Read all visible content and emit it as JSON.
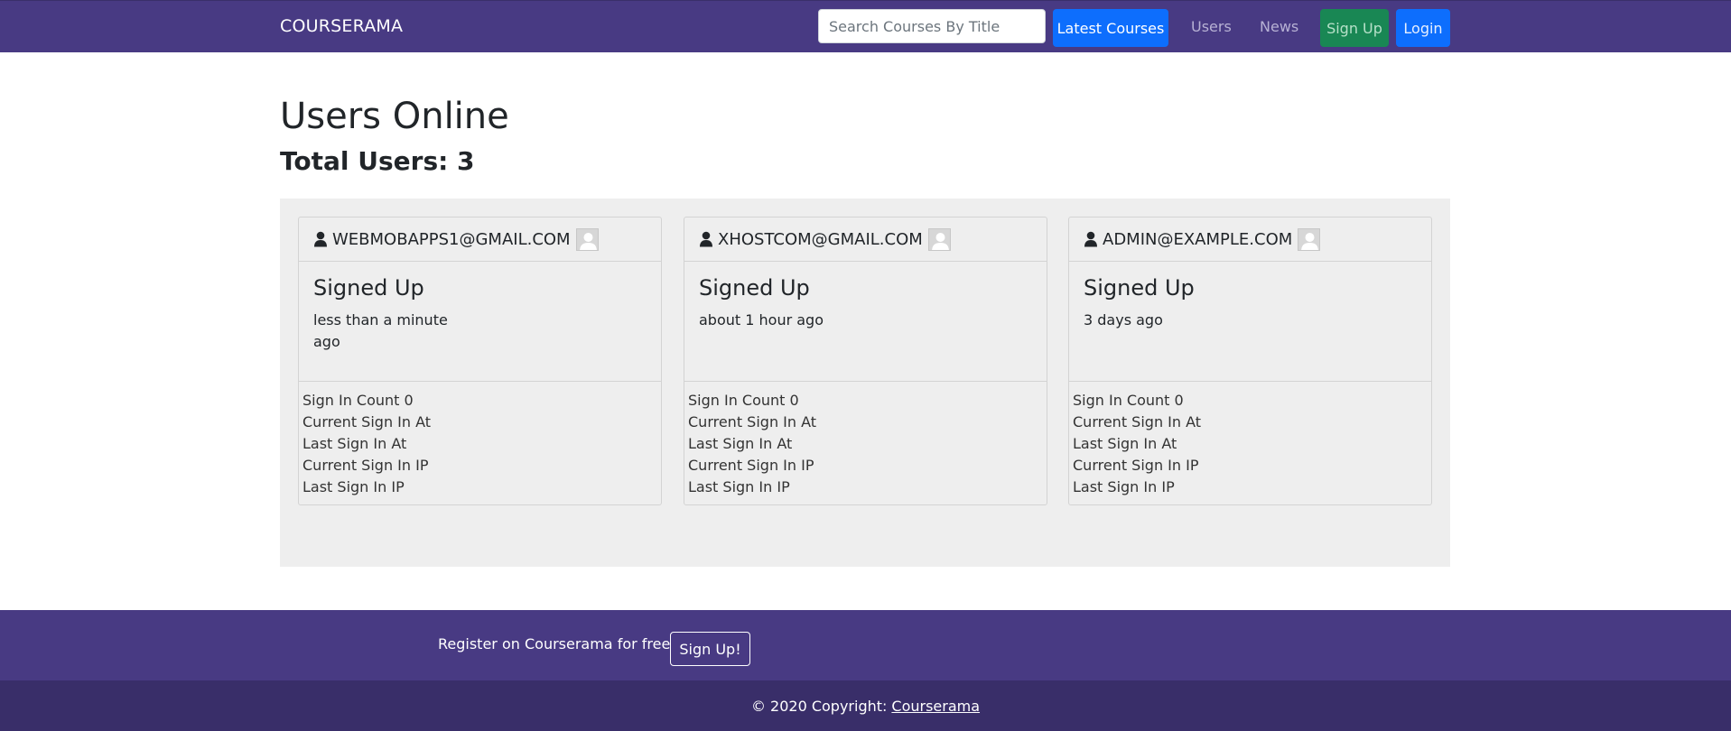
{
  "navbar": {
    "brand": "COURSERAMA",
    "search_placeholder": "Search Courses By Title",
    "latest_courses": "Latest Courses",
    "users": "Users",
    "news": "News",
    "sign_up": "Sign Up",
    "login": "Login"
  },
  "page": {
    "title": "Users Online",
    "total": "Total Users: 3"
  },
  "users": [
    {
      "email": "WEBMOBAPPS1@GMAIL.COM",
      "signed_up_label": "Signed Up",
      "ago": "less than a minute ago",
      "stats": [
        "Sign In Count 0",
        "Current Sign In At",
        "Last Sign In At",
        "Current Sign In IP",
        "Last Sign In IP"
      ]
    },
    {
      "email": "XHOSTCOM@GMAIL.COM",
      "signed_up_label": "Signed Up",
      "ago": "about 1 hour ago",
      "stats": [
        "Sign In Count 0",
        "Current Sign In At",
        "Last Sign In At",
        "Current Sign In IP",
        "Last Sign In IP"
      ]
    },
    {
      "email": "ADMIN@EXAMPLE.COM",
      "signed_up_label": "Signed Up",
      "ago": "3 days ago",
      "stats": [
        "Sign In Count 0",
        "Current Sign In At",
        "Last Sign In At",
        "Current Sign In IP",
        "Last Sign In IP"
      ]
    }
  ],
  "footer": {
    "register_text": "Register on Courserama for free",
    "sign_up_button": "Sign Up!",
    "copyright": "© 2020 Copyright:",
    "copyright_link": "Courserama"
  },
  "icons": {
    "user": "user-icon",
    "avatar": "avatar-placeholder-icon"
  },
  "colors": {
    "navbar": "#483a83",
    "primary": "#0d6efd",
    "success": "#198754",
    "panel": "#eeeeee",
    "footer_bottom": "#392e69"
  }
}
